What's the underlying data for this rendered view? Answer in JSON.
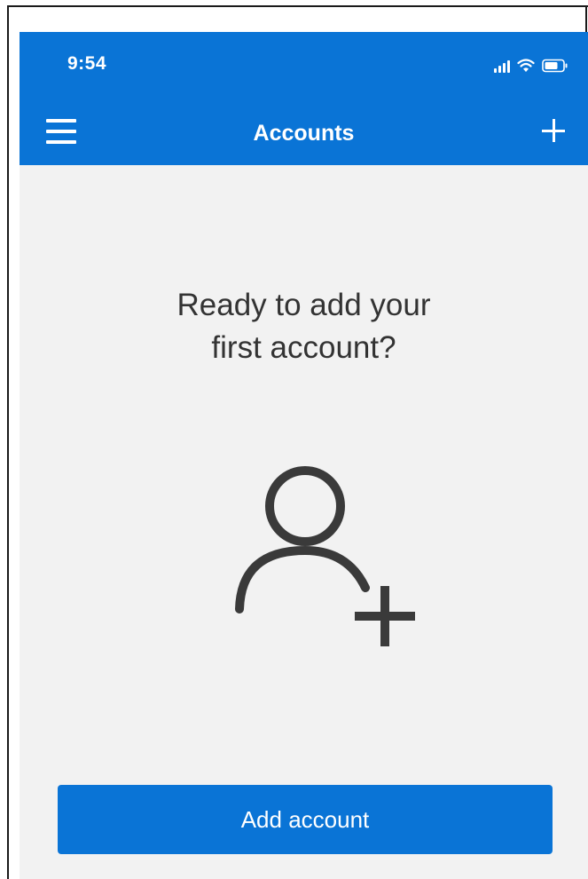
{
  "status_bar": {
    "time": "9:54",
    "icons": [
      "signal-icon",
      "wifi-icon",
      "battery-icon"
    ]
  },
  "app_bar": {
    "title": "Accounts",
    "menu_icon": "hamburger-menu-icon",
    "add_icon": "plus-icon"
  },
  "empty_state": {
    "line1": "Ready to add your",
    "line2": "first account?",
    "icon": "add-person-icon"
  },
  "primary_action": {
    "label": "Add account"
  },
  "colors": {
    "accent": "#0a74d6",
    "background": "#f2f2f2",
    "text": "#333333",
    "icon": "#3a3a3a"
  }
}
